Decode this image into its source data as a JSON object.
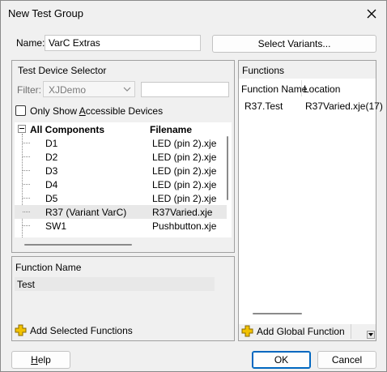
{
  "window": {
    "title": "New Test Group"
  },
  "name_field": {
    "label": "Name:",
    "value": "VarC Extras"
  },
  "select_variants_label": "Select Variants...",
  "device_selector": {
    "title": "Test Device Selector",
    "filter_label": "Filter:",
    "filter_value": "XJDemo",
    "filter_search_value": "",
    "accessible_checkbox_label_pre": "Only Show ",
    "accessible_checkbox_label_ul": "A",
    "accessible_checkbox_label_post": "ccessible Devices",
    "accessible_checked": false,
    "tree_header": {
      "col1": "All Components",
      "col2": "Filename"
    },
    "rows": [
      {
        "name": "D1",
        "file": "LED (pin 2).xje"
      },
      {
        "name": "D2",
        "file": "LED (pin 2).xje"
      },
      {
        "name": "D3",
        "file": "LED (pin 2).xje"
      },
      {
        "name": "D4",
        "file": "LED (pin 2).xje"
      },
      {
        "name": "D5",
        "file": "LED (pin 2).xje"
      },
      {
        "name": "R37 (Variant VarC)",
        "file": "R37Varied.xje"
      },
      {
        "name": "SW1",
        "file": "Pushbutton.xje"
      }
    ],
    "selected_row_index": 5
  },
  "function_name_panel": {
    "header": "Function Name",
    "items": [
      "Test"
    ],
    "add_label": "Add Selected Functions"
  },
  "functions_panel": {
    "title": "Functions",
    "col_name": "Function Name",
    "col_location": "Location",
    "rows": [
      {
        "name": "R37.Test",
        "location": "R37Varied.xje(17)"
      }
    ],
    "add_global_label": "Add Global Function"
  },
  "buttons": {
    "help_pre": "",
    "help_ul": "H",
    "help_post": "elp",
    "ok": "OK",
    "cancel": "Cancel"
  },
  "colors": {
    "accent": "#0067c0",
    "plus_icon": "#e8b400"
  }
}
